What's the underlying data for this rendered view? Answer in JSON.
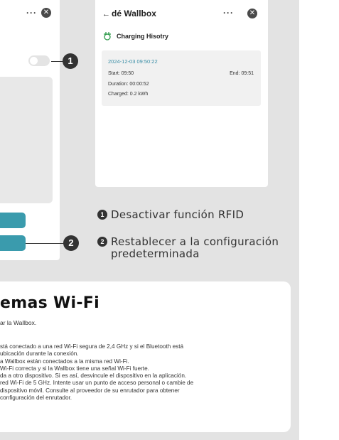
{
  "left_phone": {
    "menu_icon": "ellipsis-icon",
    "close_icon": "close-icon"
  },
  "right_phone": {
    "back_arrow": "←",
    "title": "dé Wallbox",
    "menu_icon": "ellipsis-icon",
    "close_icon": "close-icon",
    "section_icon": "charger-icon",
    "section_title": "Charging Hisotry",
    "record": {
      "datetime": "2024-12-03 09:50:22",
      "start": "Start: 09:50",
      "end": "End: 09:51",
      "duration": "Duration: 00:00:52",
      "charged": "Charged: 0.2 kWh"
    }
  },
  "markers": [
    "1",
    "2"
  ],
  "legend": [
    {
      "number": "1",
      "text": "Desactivar función RFID"
    },
    {
      "number": "2",
      "line1": "Restablecer a la configuración",
      "line2": "predeterminada"
    }
  ],
  "troubleshoot": {
    "title": "emas Wi-Fi",
    "subtitle": "ar la Wallbox.",
    "lines": [
      "stá conectado a una red Wi-Fi segura de 2,4 GHz y si el Bluetooth está",
      "ubicación durante la conexión.",
      "a Wallbox están conectados a la misma red Wi-Fi.",
      "Wi-Fi correcta y si la Wallbox tiene una señal Wi-Fi fuerte.",
      "da a otro dispositivo. Si es así, desvincule el dispositivo en la aplicación.",
      "red Wi-Fi de 5 GHz. Intente usar un punto de acceso personal o cambie de",
      "dispositivo móvil. Consulte al proveedor de su enrutador para obtener",
      "configuración del enrutador."
    ]
  },
  "colors": {
    "accent_teal": "#3a9bad",
    "date_blue": "#3a8ea6",
    "icon_green": "#2e9a4a",
    "page_grey": "#e3e3e3"
  }
}
